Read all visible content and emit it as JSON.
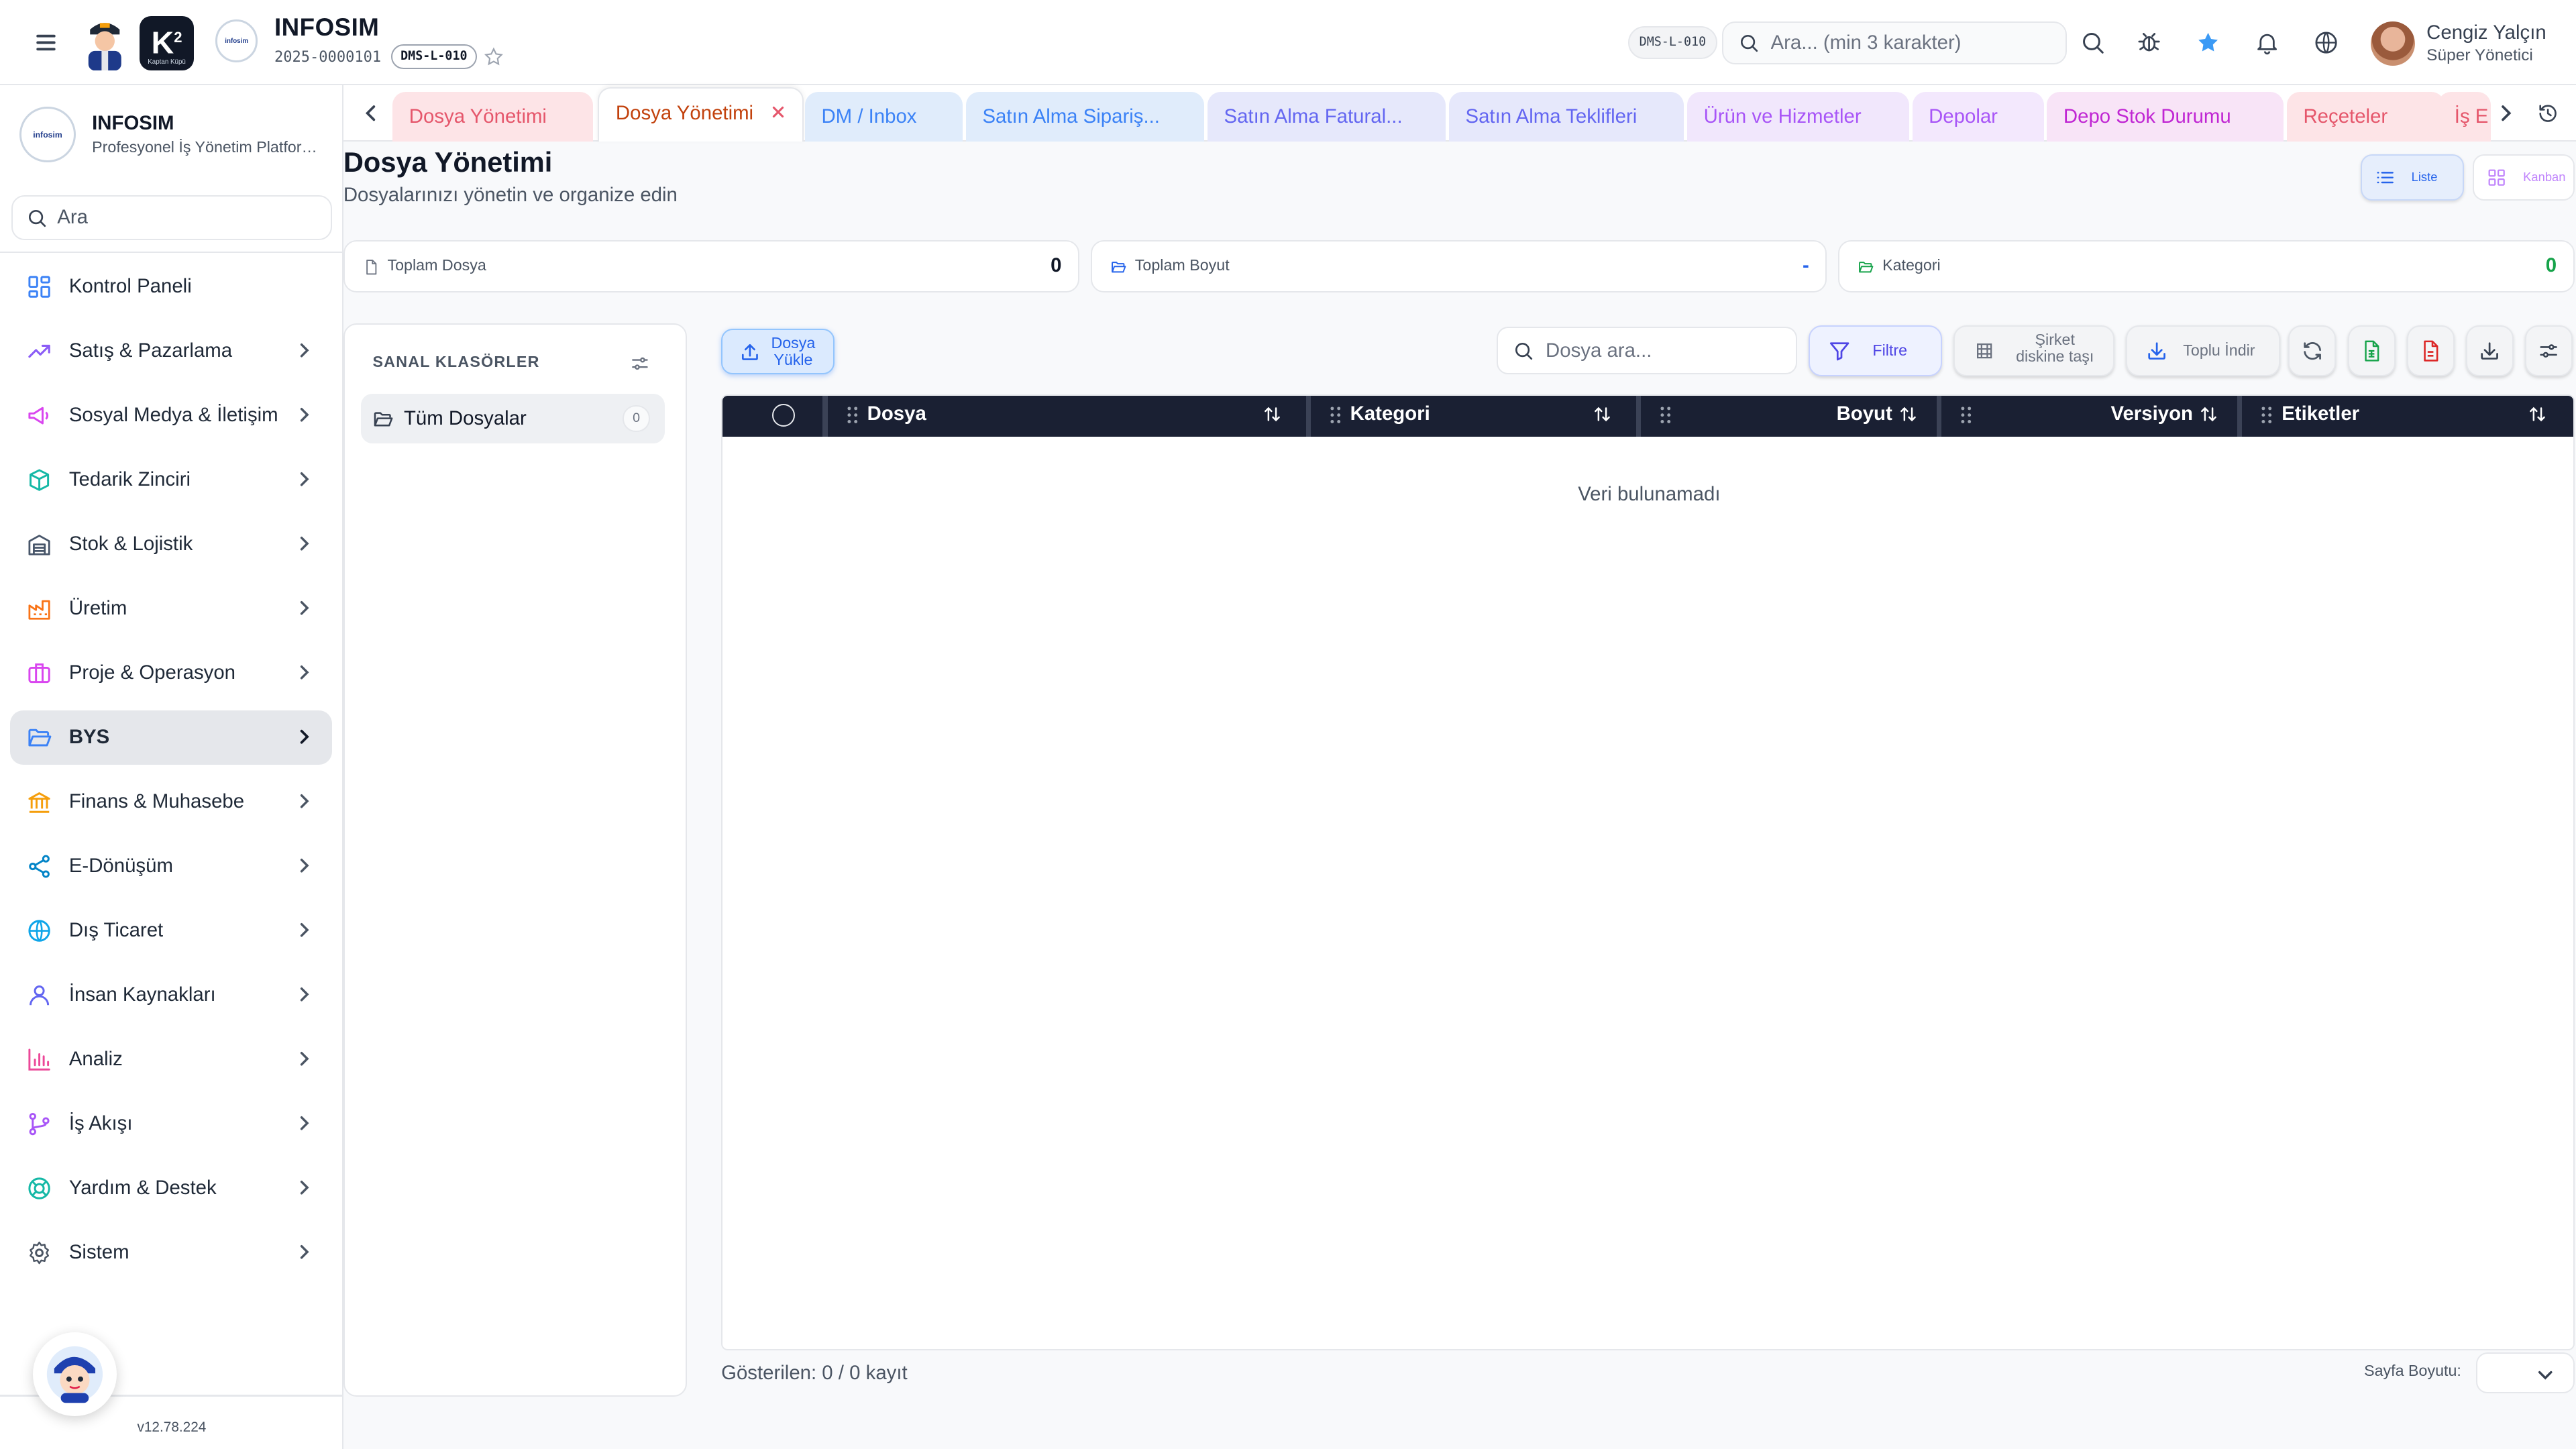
{
  "header": {
    "company_title": "INFOSIM",
    "company_code": "2025-0000101",
    "page_code": "DMS-L-010",
    "page_code_right": "DMS-L-010",
    "k2_logo_text": "K",
    "k2_logo_sup": "2",
    "k2_logo_caption": "Kaptan Küpü",
    "round_logo_text": "infosim",
    "search_placeholder": "Ara... (min 3 karakter)",
    "user_name": "Cengiz Yalçın",
    "user_role": "Süper Yönetici",
    "icons": [
      "menu-icon",
      "star-outline-icon",
      "search-icon",
      "bug-icon",
      "star-filled-icon",
      "bell-icon",
      "globe-icon"
    ]
  },
  "sidebar": {
    "brand_title": "INFOSIM",
    "brand_subtitle": "Profesyonel İş Yönetim Platformu",
    "brand_logo_text": "infosim",
    "search_placeholder": "Ara",
    "items": [
      {
        "label": "Kontrol Paneli",
        "icon": "dashboard-icon",
        "color": "#3b82f6"
      },
      {
        "label": "Satış & Pazarlama",
        "icon": "trending-up-icon",
        "color": "#8b5cf6"
      },
      {
        "label": "Sosyal Medya & İletişim",
        "icon": "megaphone-icon",
        "color": "#d946ef"
      },
      {
        "label": "Tedarik Zinciri",
        "icon": "box-icon",
        "color": "#14b8a6"
      },
      {
        "label": "Stok & Lojistik",
        "icon": "warehouse-icon",
        "color": "#64748b"
      },
      {
        "label": "Üretim",
        "icon": "factory-icon",
        "color": "#f97316"
      },
      {
        "label": "Proje & Operasyon",
        "icon": "briefcase-icon",
        "color": "#d946ef"
      },
      {
        "label": "BYS",
        "icon": "folder-open-icon",
        "color": "#3b82f6"
      },
      {
        "label": "Finans & Muhasebe",
        "icon": "bank-icon",
        "color": "#f59e0b"
      },
      {
        "label": "E-Dönüşüm",
        "icon": "share-icon",
        "color": "#0284c7"
      },
      {
        "label": "Dış Ticaret",
        "icon": "globe-icon",
        "color": "#0ea5e9"
      },
      {
        "label": "İnsan Kaynakları",
        "icon": "user-icon",
        "color": "#6366f1"
      },
      {
        "label": "Analiz",
        "icon": "bar-chart-icon",
        "color": "#ec4899"
      },
      {
        "label": "İş Akışı",
        "icon": "workflow-icon",
        "color": "#a855f7"
      },
      {
        "label": "Yardım & Destek",
        "icon": "lifebuoy-icon",
        "color": "#14b8a6"
      },
      {
        "label": "Sistem",
        "icon": "gear-icon",
        "color": "#6b7280"
      }
    ],
    "active_item": "BYS",
    "version": "v12.78.224"
  },
  "tabs": [
    {
      "label": "Dosya Yönetimi",
      "color": "#e5566b",
      "bg": "#fde4e7"
    },
    {
      "label": "Dosya Yönetimi",
      "color": "#c2410c",
      "bg": "#ffffff",
      "active": true
    },
    {
      "label": "DM / Inbox",
      "color": "#3b82f6",
      "bg": "#e0ecfb"
    },
    {
      "label": "Satın Alma Sipariş...",
      "color": "#3b82f6",
      "bg": "#e0ecfb"
    },
    {
      "label": "Satın Alma Fatural...",
      "color": "#6366f1",
      "bg": "#e6e8fb"
    },
    {
      "label": "Satın Alma Teklifleri",
      "color": "#6366f1",
      "bg": "#e6e8fb"
    },
    {
      "label": "Ürün ve Hizmetler",
      "color": "#a855f7",
      "bg": "#f1e7fc"
    },
    {
      "label": "Depolar",
      "color": "#a855f7",
      "bg": "#f3e8fd"
    },
    {
      "label": "Depo Stok Durumu",
      "color": "#c026d3",
      "bg": "#f8e4f7"
    },
    {
      "label": "Reçeteler",
      "color": "#e5566b",
      "bg": "#fde4e7"
    },
    {
      "label": "İş E",
      "color": "#e5566b",
      "bg": "#fde4e7"
    }
  ],
  "page": {
    "title": "Dosya Yönetimi",
    "subtitle": "Dosyalarınızı yönetin ve organize edin",
    "view_list_label": "Liste",
    "view_kanban_label": "Kanban",
    "active_view": "Liste"
  },
  "stats": [
    {
      "label": "Toplam Dosya",
      "value": "0",
      "icon": "file-icon",
      "value_color": "#111827"
    },
    {
      "label": "Toplam Boyut",
      "value": "-",
      "icon": "folder-icon",
      "value_color": "#2563eb"
    },
    {
      "label": "Kategori",
      "value": "0",
      "icon": "folder-icon",
      "value_color": "#16a34a"
    }
  ],
  "folders": {
    "title": "SANAL KLASÖRLER",
    "items": [
      {
        "label": "Tüm Dosyalar",
        "count": "0"
      }
    ]
  },
  "toolbar": {
    "upload_label": "Dosya Yükle",
    "search_placeholder": "Dosya ara...",
    "filter_label": "Filtre",
    "move_label": "Şirket diskine taşı",
    "bulk_download_label": "Toplu İndir",
    "icon_buttons": [
      "refresh-icon",
      "excel-icon",
      "pdf-icon",
      "download-icon",
      "settings-sliders-icon"
    ]
  },
  "table": {
    "columns": [
      "Dosya",
      "Kategori",
      "Boyut",
      "Versiyon",
      "Etiketler"
    ],
    "rows": [],
    "empty_message": "Veri bulunamadı"
  },
  "footer": {
    "record_count": "Gösterilen: 0 / 0 kayıt",
    "page_size_label": "Sayfa Boyutu:",
    "page_size_value": ""
  }
}
